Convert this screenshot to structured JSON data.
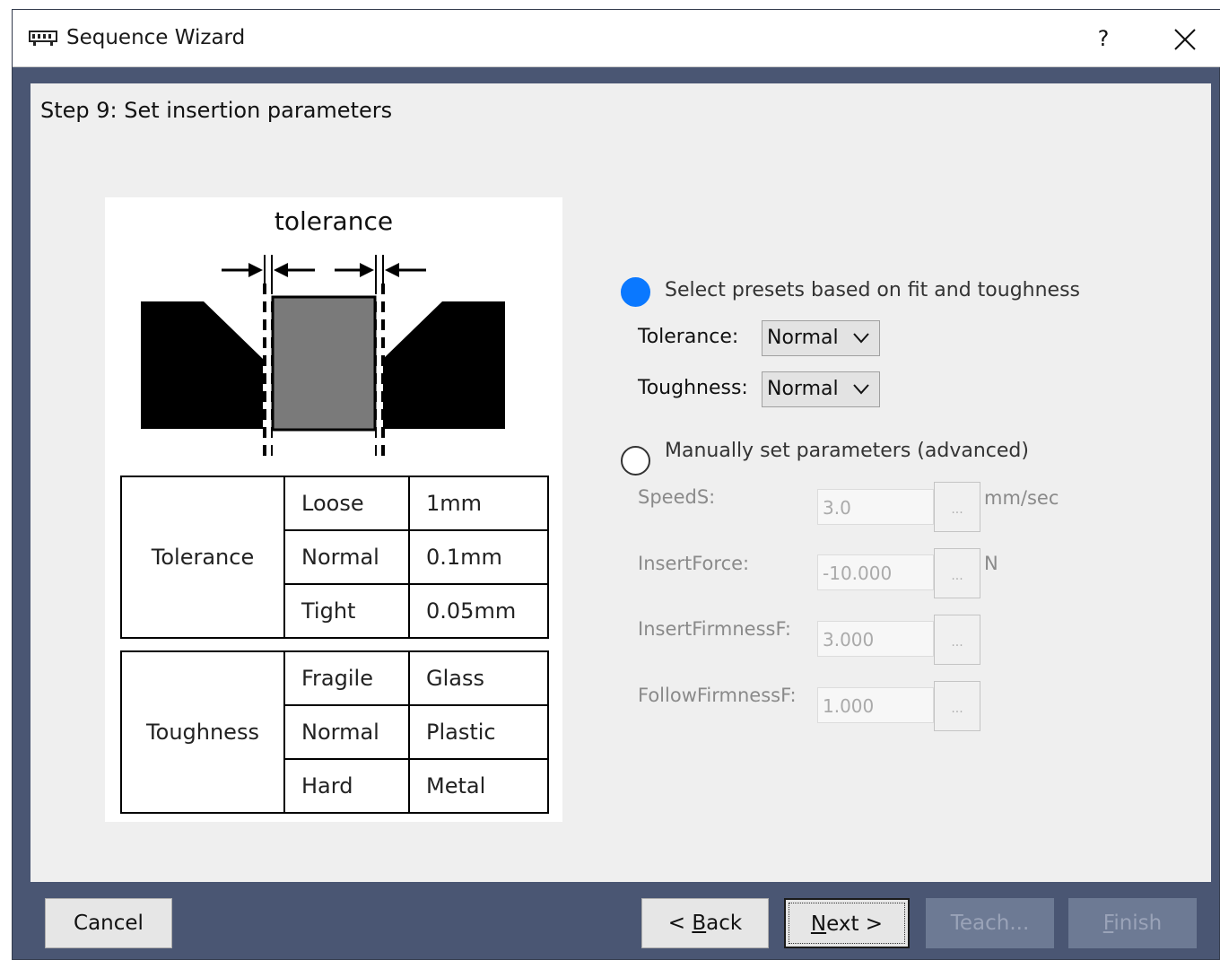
{
  "window": {
    "title": "Sequence Wizard",
    "help_label": "?"
  },
  "step_title": "Step 9: Set insertion parameters",
  "illustration": {
    "tolerance_label": "tolerance",
    "tolerance_table": {
      "header": "Tolerance",
      "rows": [
        {
          "name": "Loose",
          "value": "1mm"
        },
        {
          "name": "Normal",
          "value": "0.1mm"
        },
        {
          "name": "Tight",
          "value": "0.05mm"
        }
      ]
    },
    "toughness_table": {
      "header": "Toughness",
      "rows": [
        {
          "name": "Fragile",
          "value": "Glass"
        },
        {
          "name": "Normal",
          "value": "Plastic"
        },
        {
          "name": "Hard",
          "value": "Metal"
        }
      ]
    }
  },
  "presets": {
    "label": "Select presets based on fit and toughness",
    "selected": true,
    "tolerance_label": "Tolerance:",
    "tolerance_value": "Normal",
    "toughness_label": "Toughness:",
    "toughness_value": "Normal"
  },
  "manual": {
    "label": "Manually set parameters (advanced)",
    "selected": false,
    "fields": [
      {
        "label": "SpeedS:",
        "value": "3.0",
        "unit": "mm/sec",
        "button": "..."
      },
      {
        "label": "InsertForce:",
        "value": "-10.000",
        "unit": "N",
        "button": "..."
      },
      {
        "label": "InsertFirmnessF:",
        "value": "3.000",
        "unit": "",
        "button": "..."
      },
      {
        "label": "FollowFirmnessF:",
        "value": "1.000",
        "unit": "",
        "button": "..."
      }
    ]
  },
  "buttons": {
    "cancel": "Cancel",
    "back_prefix": "< ",
    "back_key": "B",
    "back_rest": "ack",
    "next_key": "N",
    "next_rest": "ext >",
    "teach": "Teach...",
    "finish_key": "F",
    "finish_rest": "inish"
  },
  "colors": {
    "frame": "#4a5673",
    "radio_selected": "#0a78ff",
    "panel": "#efefef"
  }
}
